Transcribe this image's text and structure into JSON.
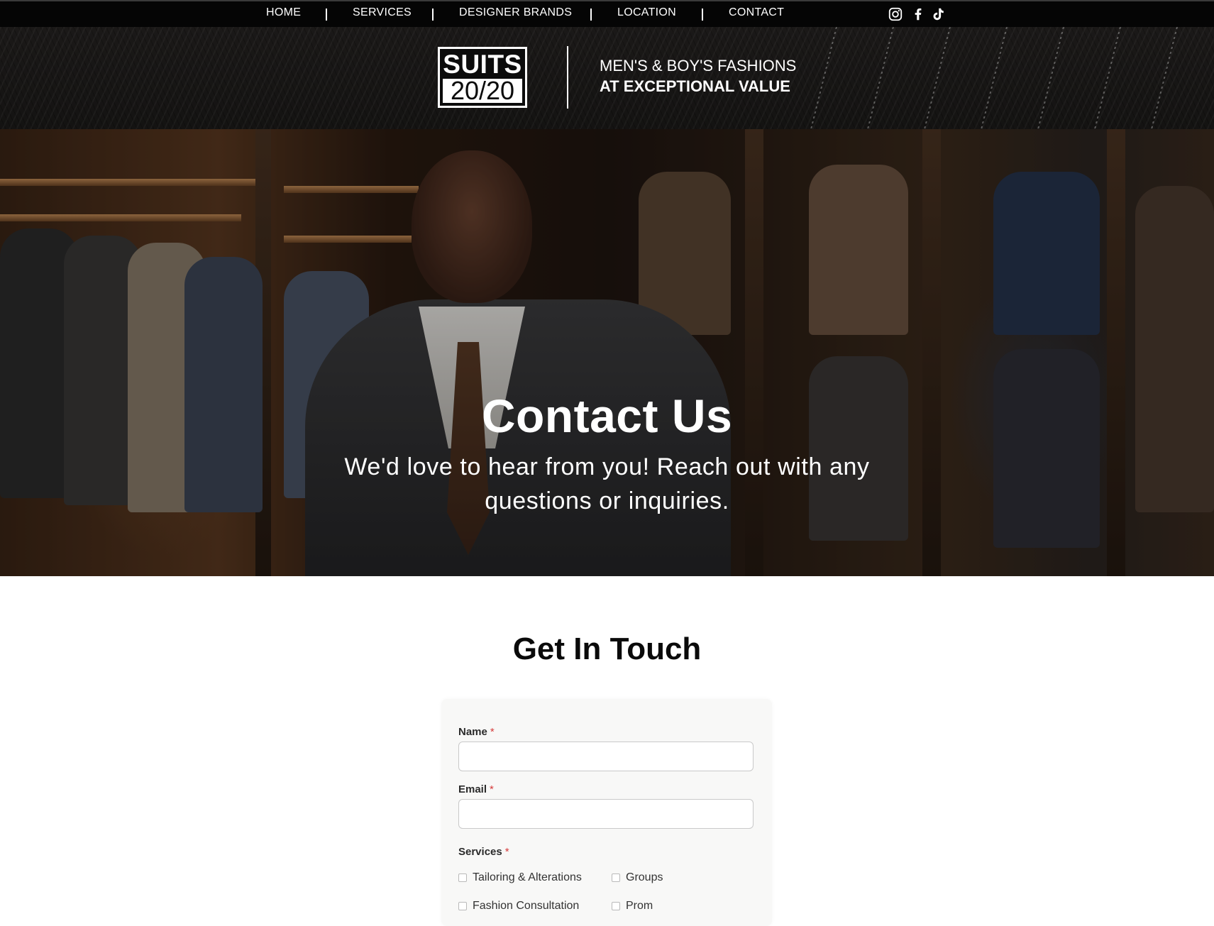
{
  "nav": {
    "items": [
      "HOME",
      "SERVICES",
      "DESIGNER BRANDS",
      "LOCATION",
      "CONTACT"
    ],
    "social": [
      "instagram-icon",
      "facebook-icon",
      "tiktok-icon"
    ]
  },
  "brand": {
    "logo_top": "SUITS",
    "logo_bottom": "20/20",
    "tagline_line1": "MEN'S & BOY'S FASHIONS",
    "tagline_line2": "AT EXCEPTIONAL VALUE"
  },
  "hero": {
    "title": "Contact Us",
    "subtitle": "We'd love to hear from you! Reach out with any questions or inquiries."
  },
  "contact": {
    "title": "Get In Touch",
    "form": {
      "name_label": "Name",
      "email_label": "Email",
      "services_label": "Services",
      "required_mark": "*",
      "name_value": "",
      "email_value": "",
      "services": [
        {
          "label": "Tailoring & Alterations",
          "checked": false
        },
        {
          "label": "Groups",
          "checked": false
        },
        {
          "label": "Fashion Consultation",
          "checked": false
        },
        {
          "label": "Prom",
          "checked": false
        }
      ]
    }
  },
  "colors": {
    "nav_bg": "#050505",
    "accent_required": "#d63b3b",
    "text_dark": "#0a0a0a"
  }
}
